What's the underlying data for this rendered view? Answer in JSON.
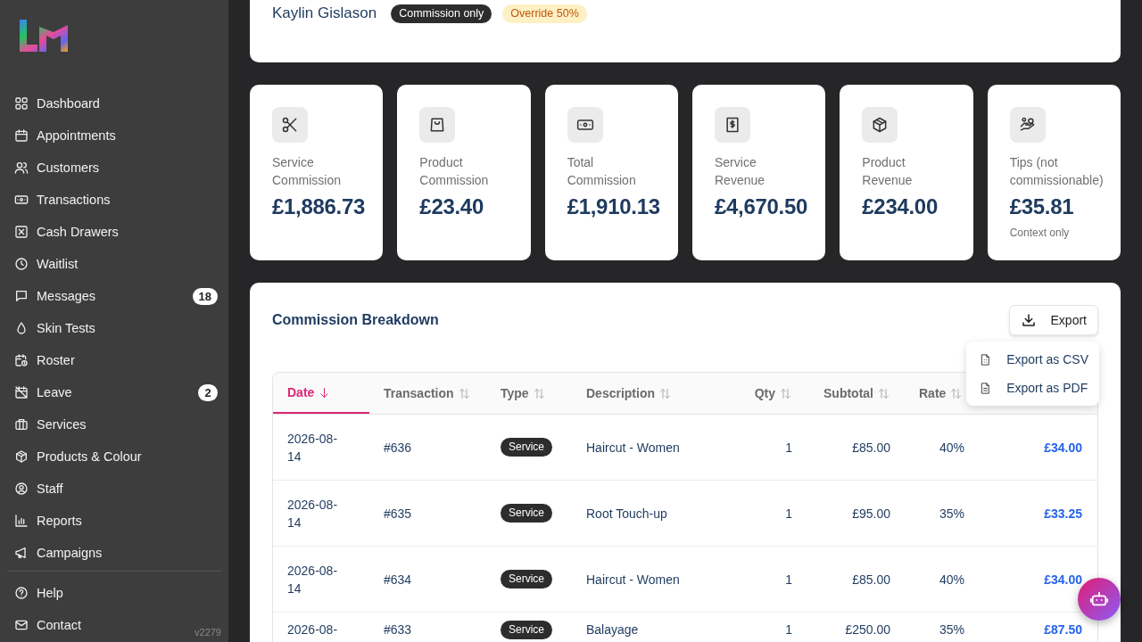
{
  "sidebar": {
    "items": [
      {
        "label": "Dashboard"
      },
      {
        "label": "Appointments"
      },
      {
        "label": "Customers"
      },
      {
        "label": "Transactions"
      },
      {
        "label": "Cash Drawers"
      },
      {
        "label": "Waitlist"
      },
      {
        "label": "Messages",
        "badge": "18"
      },
      {
        "label": "Skin Tests"
      },
      {
        "label": "Roster"
      },
      {
        "label": "Leave",
        "badge": "2"
      },
      {
        "label": "Services"
      },
      {
        "label": "Products & Colour"
      },
      {
        "label": "Staff"
      },
      {
        "label": "Reports"
      },
      {
        "label": "Campaigns"
      }
    ],
    "footer_items": [
      {
        "label": "Help"
      },
      {
        "label": "Contact"
      }
    ],
    "version": "v2279"
  },
  "staff": {
    "name": "Kaylin Gislason",
    "tags": [
      {
        "label": "Commission only",
        "kind": "dark"
      },
      {
        "label": "Override 50%",
        "kind": "warning"
      }
    ]
  },
  "stats": [
    {
      "label": "Service Commission",
      "value": "£1,886.73"
    },
    {
      "label": "Product Commission",
      "value": "£23.40"
    },
    {
      "label": "Total Commission",
      "value": "£1,910.13"
    },
    {
      "label": "Service Revenue",
      "value": "£4,670.50"
    },
    {
      "label": "Product Revenue",
      "value": "£234.00"
    },
    {
      "label": "Tips (not commissionable)",
      "value": "£35.81",
      "note": "Context only"
    }
  ],
  "breakdown": {
    "title": "Commission Breakdown",
    "export_button": "Export",
    "export_menu": [
      {
        "label": "Export as CSV"
      },
      {
        "label": "Export as PDF"
      }
    ],
    "columns": [
      {
        "label": "Date",
        "active": true
      },
      {
        "label": "Transaction",
        "active": false
      },
      {
        "label": "Type",
        "active": false
      },
      {
        "label": "Description",
        "active": false
      },
      {
        "label": "Qty",
        "active": false
      },
      {
        "label": "Subtotal",
        "active": false
      },
      {
        "label": "Rate",
        "active": false
      }
    ],
    "rows": [
      {
        "date": "2026-08-14",
        "transaction": "#636",
        "type": "Service",
        "description": "Haircut - Women",
        "qty": "1",
        "subtotal": "£85.00",
        "rate": "40%",
        "commission": "£34.00"
      },
      {
        "date": "2026-08-14",
        "transaction": "#635",
        "type": "Service",
        "description": "Root Touch-up",
        "qty": "1",
        "subtotal": "£95.00",
        "rate": "35%",
        "commission": "£33.25"
      },
      {
        "date": "2026-08-14",
        "transaction": "#634",
        "type": "Service",
        "description": "Haircut - Women",
        "qty": "1",
        "subtotal": "£85.00",
        "rate": "40%",
        "commission": "£34.00"
      },
      {
        "date": "2026-08-",
        "transaction": "#633",
        "type": "Service",
        "description": "Balayage",
        "qty": "1",
        "subtotal": "£250.00",
        "rate": "35%",
        "commission": "£87.50"
      }
    ]
  }
}
